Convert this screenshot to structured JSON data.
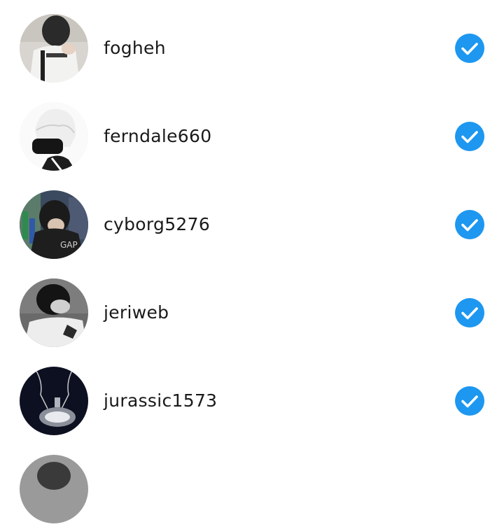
{
  "users": [
    {
      "username": "fogheh",
      "selected": true,
      "avatar_icon": "profile-photo"
    },
    {
      "username": "ferndale660",
      "selected": true,
      "avatar_icon": "profile-photo"
    },
    {
      "username": "cyborg5276",
      "selected": true,
      "avatar_icon": "profile-photo"
    },
    {
      "username": "jeriweb",
      "selected": true,
      "avatar_icon": "profile-photo"
    },
    {
      "username": "jurassic1573",
      "selected": true,
      "avatar_icon": "profile-photo"
    }
  ],
  "accent_color": "#1d97f0"
}
